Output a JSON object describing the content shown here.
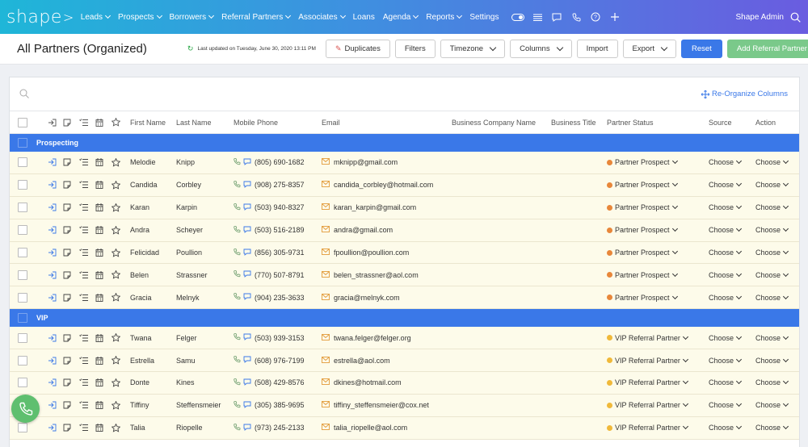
{
  "nav": {
    "logo": "shape",
    "items": [
      {
        "label": "Leads",
        "caret": true
      },
      {
        "label": "Prospects",
        "caret": true
      },
      {
        "label": "Borrowers",
        "caret": true
      },
      {
        "label": "Referral Partners",
        "caret": true
      },
      {
        "label": "Associates",
        "caret": true
      },
      {
        "label": "Loans",
        "caret": false
      },
      {
        "label": "Agenda",
        "caret": true
      },
      {
        "label": "Reports",
        "caret": true
      },
      {
        "label": "Settings",
        "caret": false
      }
    ],
    "icons": [
      "toggle-icon",
      "list-icon",
      "chat-icon",
      "phone-icon",
      "help-icon",
      "plus-icon"
    ],
    "user": "Shape Admin"
  },
  "toolbar": {
    "title": "All Partners (Organized)",
    "updated": "Last updated on Tuesday, June 30, 2020 13:11 PM",
    "duplicates": "Duplicates",
    "filters": "Filters",
    "timezone": "Timezone",
    "columns": "Columns",
    "import": "Import",
    "export": "Export",
    "reset": "Reset",
    "add": "Add Referral Partner"
  },
  "panel": {
    "reorganize": "Re-Organize Columns"
  },
  "columns": {
    "first": "First Name",
    "last": "Last Name",
    "phone": "Mobile Phone",
    "email": "Email",
    "company": "Business Company Name",
    "btitle": "Business Title",
    "status": "Partner Status",
    "source": "Source",
    "action": "Action"
  },
  "choose": "Choose",
  "colors": {
    "prospect": "#e8873a",
    "vip": "#f0b93a",
    "group": "#3a78e8"
  },
  "groups": [
    {
      "name": "Prospecting",
      "rows": [
        {
          "first": "Melodie",
          "last": "Knipp",
          "phone": "(805) 690-1682",
          "email": "mknipp@gmail.com",
          "status": "Partner Prospect"
        },
        {
          "first": "Candida",
          "last": "Corbley",
          "phone": "(908) 275-8357",
          "email": "candida_corbley@hotmail.com",
          "status": "Partner Prospect"
        },
        {
          "first": "Karan",
          "last": "Karpin",
          "phone": "(503) 940-8327",
          "email": "karan_karpin@gmail.com",
          "status": "Partner Prospect"
        },
        {
          "first": "Andra",
          "last": "Scheyer",
          "phone": "(503) 516-2189",
          "email": "andra@gmail.com",
          "status": "Partner Prospect"
        },
        {
          "first": "Felicidad",
          "last": "Poullion",
          "phone": "(856) 305-9731",
          "email": "fpoullion@poullion.com",
          "status": "Partner Prospect"
        },
        {
          "first": "Belen",
          "last": "Strassner",
          "phone": "(770) 507-8791",
          "email": "belen_strassner@aol.com",
          "status": "Partner Prospect"
        },
        {
          "first": "Gracia",
          "last": "Melnyk",
          "phone": "(904) 235-3633",
          "email": "gracia@melnyk.com",
          "status": "Partner Prospect"
        }
      ]
    },
    {
      "name": "VIP",
      "rows": [
        {
          "first": "Twana",
          "last": "Felger",
          "phone": "(503) 939-3153",
          "email": "twana.felger@felger.org",
          "status": "VIP Referral Partner"
        },
        {
          "first": "Estrella",
          "last": "Samu",
          "phone": "(608) 976-7199",
          "email": "estrella@aol.com",
          "status": "VIP Referral Partner"
        },
        {
          "first": "Donte",
          "last": "Kines",
          "phone": "(508) 429-8576",
          "email": "dkines@hotmail.com",
          "status": "VIP Referral Partner"
        },
        {
          "first": "Tiffiny",
          "last": "Steffensmeier",
          "phone": "(305) 385-9695",
          "email": "tiffiny_steffensmeier@cox.net",
          "status": "VIP Referral Partner"
        },
        {
          "first": "Talia",
          "last": "Riopelle",
          "phone": "(973) 245-2133",
          "email": "talia_riopelle@aol.com",
          "status": "VIP Referral Partner"
        }
      ]
    }
  ]
}
